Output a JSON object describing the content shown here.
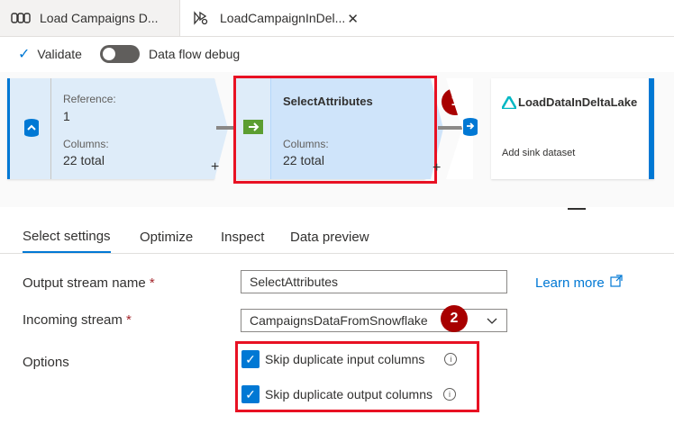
{
  "tabs": [
    {
      "label": "Load Campaigns D..."
    },
    {
      "label": "LoadCampaignInDel..."
    }
  ],
  "toolbar": {
    "validate_label": "Validate",
    "debug_label": "Data flow debug"
  },
  "nodes": {
    "source": {
      "ref_label": "Reference:",
      "ref_value": "1",
      "cols_label": "Columns:",
      "cols_value": "22 total"
    },
    "select": {
      "title": "SelectAttributes",
      "cols_label": "Columns:",
      "cols_value": "22 total"
    },
    "sink": {
      "title": "LoadDataInDeltaLake",
      "subtitle": "Add sink dataset"
    },
    "plus1": "+",
    "plus2": "+"
  },
  "badges": {
    "one": "1",
    "two": "2"
  },
  "settings_tabs": [
    {
      "label": "Select settings"
    },
    {
      "label": "Optimize"
    },
    {
      "label": "Inspect"
    },
    {
      "label": "Data preview"
    }
  ],
  "form": {
    "output_label": "Output stream name",
    "output_value": "SelectAttributes",
    "incoming_label": "Incoming stream",
    "incoming_value": "CampaignsDataFromSnowflake",
    "options_label": "Options",
    "required_mark": "*",
    "learn_more": "Learn more",
    "opt1": "Skip duplicate input columns",
    "opt2": "Skip duplicate output columns"
  },
  "colors": {
    "accent": "#0078d4",
    "highlight": "#e81123",
    "badge": "#a80000"
  }
}
